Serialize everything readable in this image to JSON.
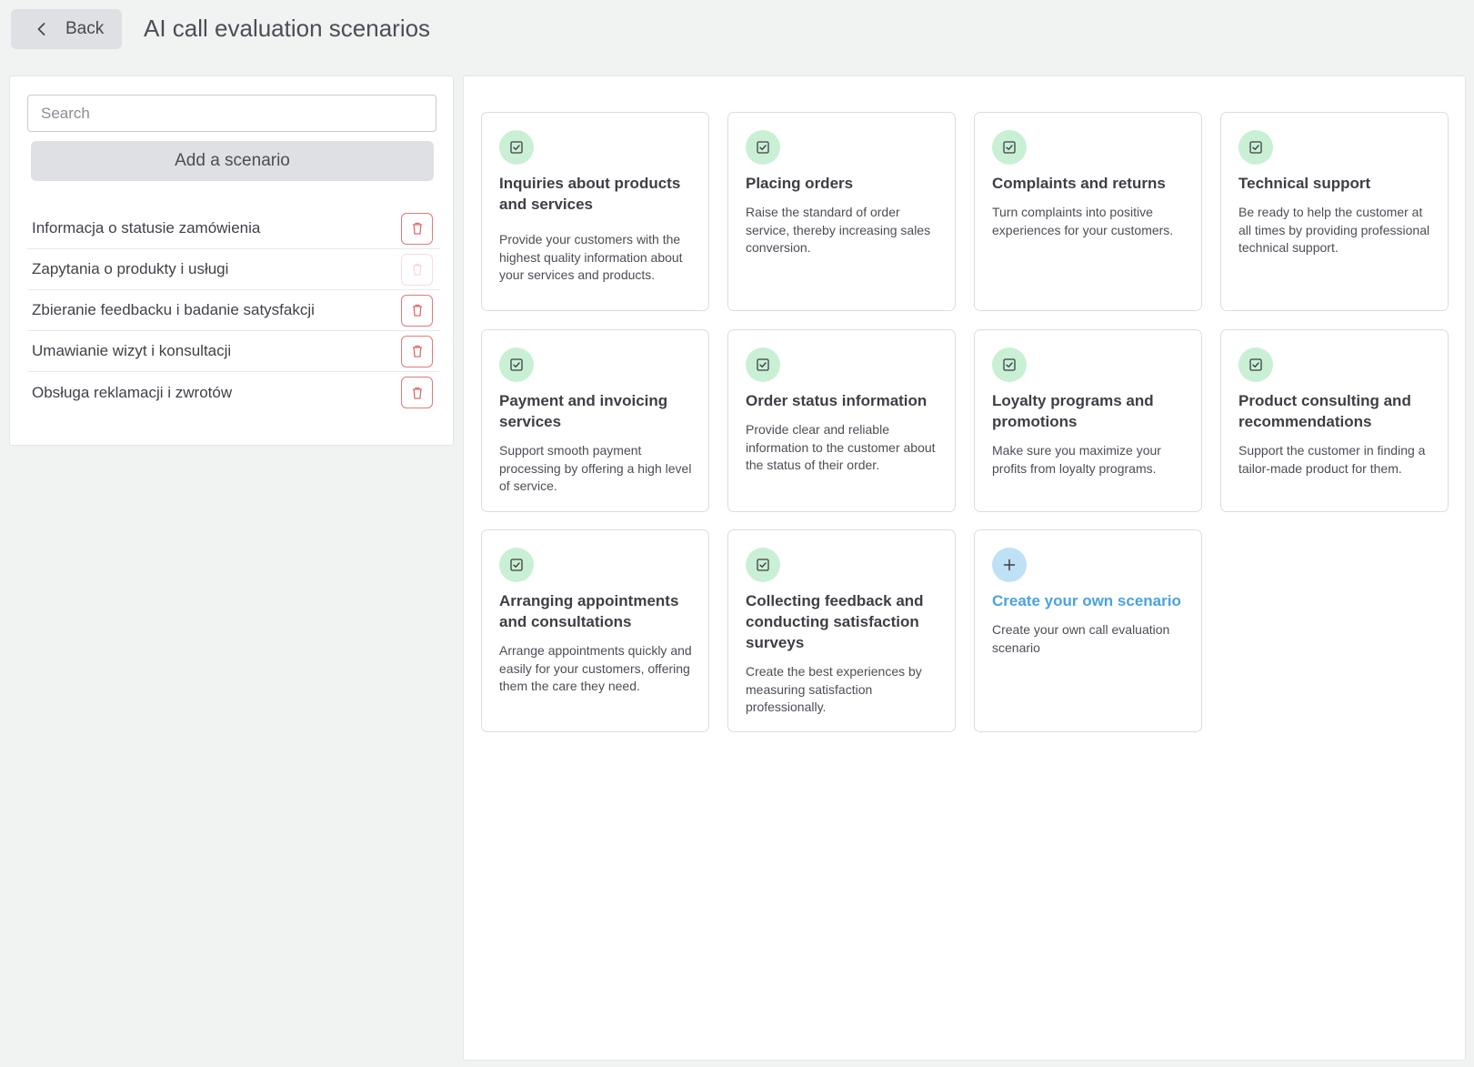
{
  "header": {
    "back_label": "Back",
    "title": "AI call evaluation scenarios"
  },
  "sidebar": {
    "search_placeholder": "Search",
    "add_label": "Add a scenario",
    "items": [
      {
        "label": "Informacja o statusie zamówienia",
        "delete_enabled": true
      },
      {
        "label": "Zapytania o produkty i usługi",
        "delete_enabled": false
      },
      {
        "label": "Zbieranie feedbacku i badanie satysfakcji",
        "delete_enabled": true
      },
      {
        "label": "Umawianie wizyt i konsultacji",
        "delete_enabled": true
      },
      {
        "label": "Obsługa reklamacji i zwrotów",
        "delete_enabled": true
      }
    ]
  },
  "cards": [
    {
      "icon": "check-square-icon",
      "title": "Inquiries about products and services",
      "desc": "Provide your customers with the highest quality information about your services and products."
    },
    {
      "icon": "check-square-icon",
      "title": "Placing orders",
      "desc": "Raise the standard of order service, thereby increasing sales conversion."
    },
    {
      "icon": "check-square-icon",
      "title": "Complaints and returns",
      "desc": "Turn complaints into positive experiences for your customers."
    },
    {
      "icon": "check-square-icon",
      "title": "Technical support",
      "desc": "Be ready to help the customer at all times by providing professional technical support."
    },
    {
      "icon": "check-square-icon",
      "title": "Payment and invoicing services",
      "desc": "Support smooth payment processing by offering a high level of service."
    },
    {
      "icon": "check-square-icon",
      "title": "Order status information",
      "desc": "Provide clear and reliable information to the customer about the status of their order."
    },
    {
      "icon": "check-square-icon",
      "title": "Loyalty programs and promotions",
      "desc": "Make sure you maximize your profits from loyalty programs."
    },
    {
      "icon": "check-square-icon",
      "title": "Product consulting and recommendations",
      "desc": "Support the customer in finding a tailor-made product for them."
    },
    {
      "icon": "check-square-icon",
      "title": "Arranging appointments and consultations",
      "desc": "Arrange appointments quickly and easily for your customers, offering them the care they need."
    },
    {
      "icon": "check-square-icon",
      "title": "Collecting feedback and conducting satisfaction surveys",
      "desc": "Create the best experiences by measuring satisfaction professionally."
    },
    {
      "icon": "plus-icon",
      "title": "Create your own scenario",
      "desc": "Create your own call evaluation scenario"
    }
  ],
  "colors": {
    "accent": "#4aa3de",
    "success_bg": "#c9f0d5",
    "danger": "#e07a7a"
  }
}
